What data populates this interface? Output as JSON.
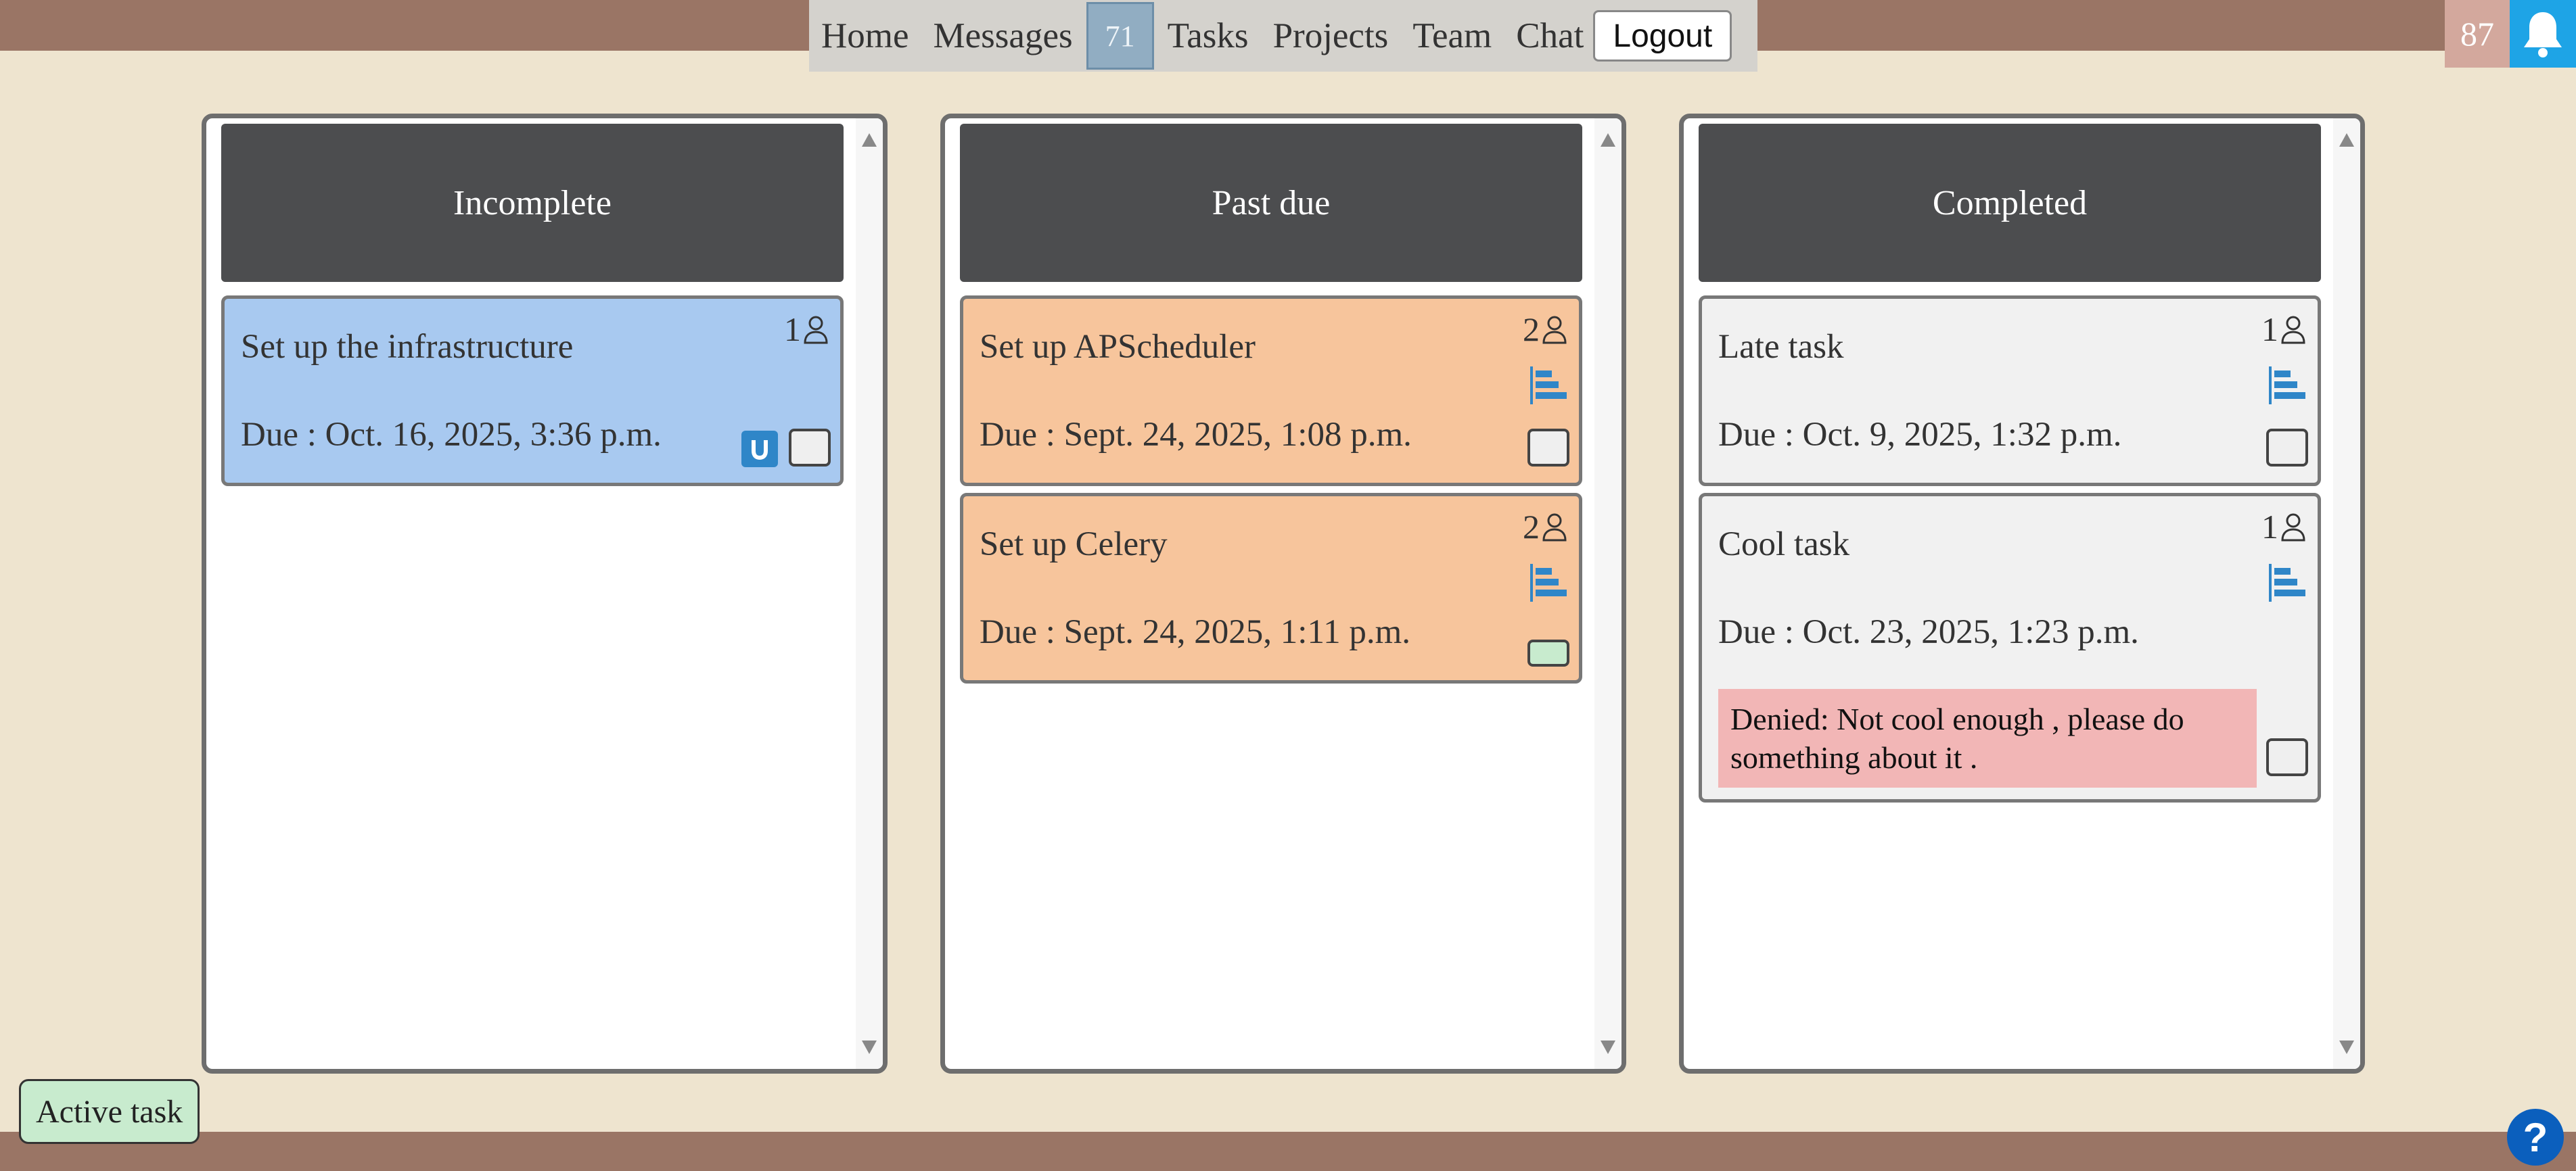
{
  "nav": {
    "items": [
      "Home",
      "Messages",
      "Tasks",
      "Projects",
      "Team",
      "Chat"
    ],
    "messages_count": "71",
    "logout_label": "Logout"
  },
  "notifications": {
    "count": "87",
    "icon": "bell-icon"
  },
  "columns": [
    {
      "title": "Incomplete",
      "cards": [
        {
          "title": "Set up the infrastructure",
          "due": "Due : Oct. 16, 2025, 3:36 p.m.",
          "assignees": "1",
          "badge": "U",
          "color": "#a8c9f0"
        }
      ]
    },
    {
      "title": "Past due",
      "cards": [
        {
          "title": "Set up APScheduler",
          "due": "Due : Sept. 24, 2025, 1:08 p.m.",
          "assignees": "2",
          "color": "#f7c59c"
        },
        {
          "title": "Set up Celery",
          "due": "Due : Sept. 24, 2025, 1:11 p.m.",
          "assignees": "2",
          "color": "#f7c59c",
          "checkbox_color": "#c8ebce"
        }
      ]
    },
    {
      "title": "Completed",
      "cards": [
        {
          "title": "Late task",
          "due": "Due : Oct. 9, 2025, 1:32 p.m.",
          "assignees": "1",
          "color": "#f1f1f1"
        },
        {
          "title": "Cool task",
          "due": "Due : Oct. 23, 2025, 1:23 p.m.",
          "assignees": "1",
          "denied": "Denied: Not cool enough , please do something about it .",
          "color": "#f1f1f1"
        }
      ]
    }
  ],
  "footer": {
    "active_task_label": "Active task",
    "help_label": "?"
  },
  "colors": {
    "bar": "#9a7565",
    "background": "#eee4cf",
    "column_header": "#4c4d4f",
    "accent": "#2f86c8",
    "denied": "#f2b6b6"
  }
}
